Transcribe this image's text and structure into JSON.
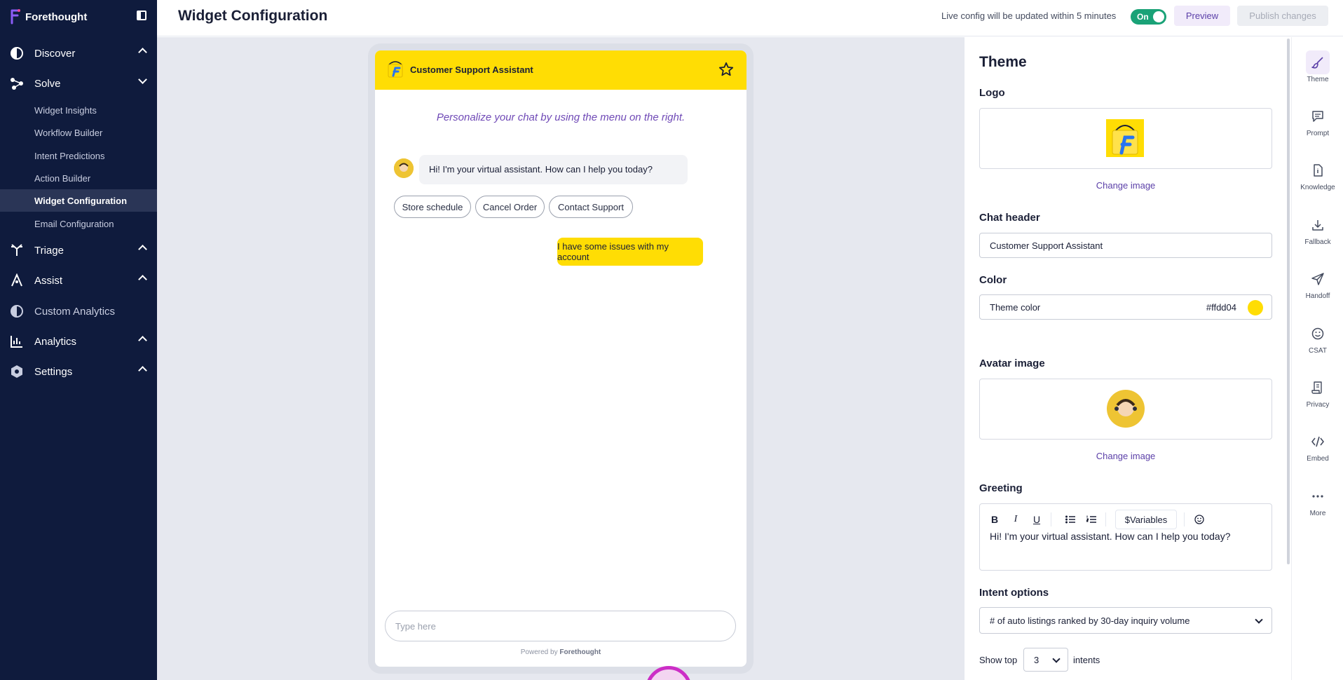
{
  "app": {
    "brand": "Forethought"
  },
  "sidebar": {
    "nav": [
      {
        "label": "Discover",
        "icon": "discover-icon",
        "expanded": false
      },
      {
        "label": "Solve",
        "icon": "solve-icon",
        "expanded": true
      },
      {
        "label": "Triage",
        "icon": "triage-icon",
        "expanded": false
      },
      {
        "label": "Assist",
        "icon": "assist-icon",
        "expanded": false
      },
      {
        "label": "Custom Analytics",
        "icon": "custom-analytics-icon"
      },
      {
        "label": "Analytics",
        "icon": "analytics-icon",
        "expanded": false
      },
      {
        "label": "Settings",
        "icon": "settings-icon",
        "expanded": false
      }
    ],
    "solve_items": [
      "Widget Insights",
      "Workflow Builder",
      "Intent Predictions",
      "Action Builder",
      "Widget Configuration",
      "Email Configuration"
    ],
    "active_item": "Widget Configuration"
  },
  "header": {
    "title": "Widget Configuration",
    "live_note": "Live config will be updated within 5 minutes",
    "toggle_label": "On",
    "preview": "Preview",
    "publish": "Publish changes"
  },
  "preview": {
    "header_title": "Customer Support Assistant",
    "personalize": "Personalize your chat by using the menu on the right.",
    "bot_message": "Hi! I'm your virtual assistant. How can I help you today?",
    "chips": [
      "Store schedule",
      "Cancel Order",
      "Contact Support"
    ],
    "user_message": "I have some issues with my account",
    "input_placeholder": "Type here",
    "powered_by": "Powered by",
    "powered_brand": "Forethought"
  },
  "panel": {
    "title": "Theme",
    "logo_label": "Logo",
    "change_image": "Change image",
    "chat_header_label": "Chat header",
    "chat_header_value": "Customer Support Assistant",
    "color_label": "Color",
    "theme_color_label": "Theme color",
    "theme_color_value": "#ffdd04",
    "avatar_label": "Avatar image",
    "greeting_label": "Greeting",
    "variables_label": "$Variables",
    "greeting_text": "Hi! I'm your virtual assistant. How can I help you today?",
    "intent_options_label": "Intent options",
    "intent_select_value": "# of auto listings ranked by 30-day inquiry volume",
    "show_top_label": "Show top",
    "show_top_value": "3",
    "intents_label": "intents"
  },
  "rail": [
    {
      "label": "Theme",
      "icon": "brush-icon",
      "active": true
    },
    {
      "label": "Prompt",
      "icon": "prompt-icon"
    },
    {
      "label": "Knowledge",
      "icon": "knowledge-icon"
    },
    {
      "label": "Fallback",
      "icon": "fallback-icon"
    },
    {
      "label": "Handoff",
      "icon": "handoff-icon"
    },
    {
      "label": "CSAT",
      "icon": "csat-icon"
    },
    {
      "label": "Privacy",
      "icon": "privacy-icon"
    },
    {
      "label": "Embed",
      "icon": "embed-icon"
    },
    {
      "label": "More",
      "icon": "more-icon"
    }
  ],
  "colors": {
    "sidebar_bg": "#0f1b3d",
    "theme_yellow": "#ffdd04",
    "accent_purple": "#5b3fa8",
    "toggle_green": "#1aa277"
  }
}
